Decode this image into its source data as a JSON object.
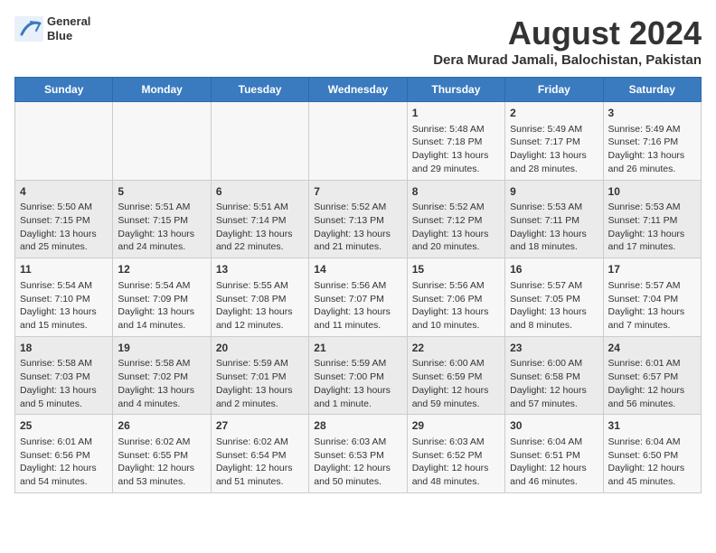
{
  "header": {
    "logo_line1": "General",
    "logo_line2": "Blue",
    "main_title": "August 2024",
    "subtitle": "Dera Murad Jamali, Balochistan, Pakistan"
  },
  "days_of_week": [
    "Sunday",
    "Monday",
    "Tuesday",
    "Wednesday",
    "Thursday",
    "Friday",
    "Saturday"
  ],
  "weeks": [
    [
      {
        "day": "",
        "content": ""
      },
      {
        "day": "",
        "content": ""
      },
      {
        "day": "",
        "content": ""
      },
      {
        "day": "",
        "content": ""
      },
      {
        "day": "1",
        "content": "Sunrise: 5:48 AM\nSunset: 7:18 PM\nDaylight: 13 hours\nand 29 minutes."
      },
      {
        "day": "2",
        "content": "Sunrise: 5:49 AM\nSunset: 7:17 PM\nDaylight: 13 hours\nand 28 minutes."
      },
      {
        "day": "3",
        "content": "Sunrise: 5:49 AM\nSunset: 7:16 PM\nDaylight: 13 hours\nand 26 minutes."
      }
    ],
    [
      {
        "day": "4",
        "content": "Sunrise: 5:50 AM\nSunset: 7:15 PM\nDaylight: 13 hours\nand 25 minutes."
      },
      {
        "day": "5",
        "content": "Sunrise: 5:51 AM\nSunset: 7:15 PM\nDaylight: 13 hours\nand 24 minutes."
      },
      {
        "day": "6",
        "content": "Sunrise: 5:51 AM\nSunset: 7:14 PM\nDaylight: 13 hours\nand 22 minutes."
      },
      {
        "day": "7",
        "content": "Sunrise: 5:52 AM\nSunset: 7:13 PM\nDaylight: 13 hours\nand 21 minutes."
      },
      {
        "day": "8",
        "content": "Sunrise: 5:52 AM\nSunset: 7:12 PM\nDaylight: 13 hours\nand 20 minutes."
      },
      {
        "day": "9",
        "content": "Sunrise: 5:53 AM\nSunset: 7:11 PM\nDaylight: 13 hours\nand 18 minutes."
      },
      {
        "day": "10",
        "content": "Sunrise: 5:53 AM\nSunset: 7:11 PM\nDaylight: 13 hours\nand 17 minutes."
      }
    ],
    [
      {
        "day": "11",
        "content": "Sunrise: 5:54 AM\nSunset: 7:10 PM\nDaylight: 13 hours\nand 15 minutes."
      },
      {
        "day": "12",
        "content": "Sunrise: 5:54 AM\nSunset: 7:09 PM\nDaylight: 13 hours\nand 14 minutes."
      },
      {
        "day": "13",
        "content": "Sunrise: 5:55 AM\nSunset: 7:08 PM\nDaylight: 13 hours\nand 12 minutes."
      },
      {
        "day": "14",
        "content": "Sunrise: 5:56 AM\nSunset: 7:07 PM\nDaylight: 13 hours\nand 11 minutes."
      },
      {
        "day": "15",
        "content": "Sunrise: 5:56 AM\nSunset: 7:06 PM\nDaylight: 13 hours\nand 10 minutes."
      },
      {
        "day": "16",
        "content": "Sunrise: 5:57 AM\nSunset: 7:05 PM\nDaylight: 13 hours\nand 8 minutes."
      },
      {
        "day": "17",
        "content": "Sunrise: 5:57 AM\nSunset: 7:04 PM\nDaylight: 13 hours\nand 7 minutes."
      }
    ],
    [
      {
        "day": "18",
        "content": "Sunrise: 5:58 AM\nSunset: 7:03 PM\nDaylight: 13 hours\nand 5 minutes."
      },
      {
        "day": "19",
        "content": "Sunrise: 5:58 AM\nSunset: 7:02 PM\nDaylight: 13 hours\nand 4 minutes."
      },
      {
        "day": "20",
        "content": "Sunrise: 5:59 AM\nSunset: 7:01 PM\nDaylight: 13 hours\nand 2 minutes."
      },
      {
        "day": "21",
        "content": "Sunrise: 5:59 AM\nSunset: 7:00 PM\nDaylight: 13 hours\nand 1 minute."
      },
      {
        "day": "22",
        "content": "Sunrise: 6:00 AM\nSunset: 6:59 PM\nDaylight: 12 hours\nand 59 minutes."
      },
      {
        "day": "23",
        "content": "Sunrise: 6:00 AM\nSunset: 6:58 PM\nDaylight: 12 hours\nand 57 minutes."
      },
      {
        "day": "24",
        "content": "Sunrise: 6:01 AM\nSunset: 6:57 PM\nDaylight: 12 hours\nand 56 minutes."
      }
    ],
    [
      {
        "day": "25",
        "content": "Sunrise: 6:01 AM\nSunset: 6:56 PM\nDaylight: 12 hours\nand 54 minutes."
      },
      {
        "day": "26",
        "content": "Sunrise: 6:02 AM\nSunset: 6:55 PM\nDaylight: 12 hours\nand 53 minutes."
      },
      {
        "day": "27",
        "content": "Sunrise: 6:02 AM\nSunset: 6:54 PM\nDaylight: 12 hours\nand 51 minutes."
      },
      {
        "day": "28",
        "content": "Sunrise: 6:03 AM\nSunset: 6:53 PM\nDaylight: 12 hours\nand 50 minutes."
      },
      {
        "day": "29",
        "content": "Sunrise: 6:03 AM\nSunset: 6:52 PM\nDaylight: 12 hours\nand 48 minutes."
      },
      {
        "day": "30",
        "content": "Sunrise: 6:04 AM\nSunset: 6:51 PM\nDaylight: 12 hours\nand 46 minutes."
      },
      {
        "day": "31",
        "content": "Sunrise: 6:04 AM\nSunset: 6:50 PM\nDaylight: 12 hours\nand 45 minutes."
      }
    ]
  ]
}
